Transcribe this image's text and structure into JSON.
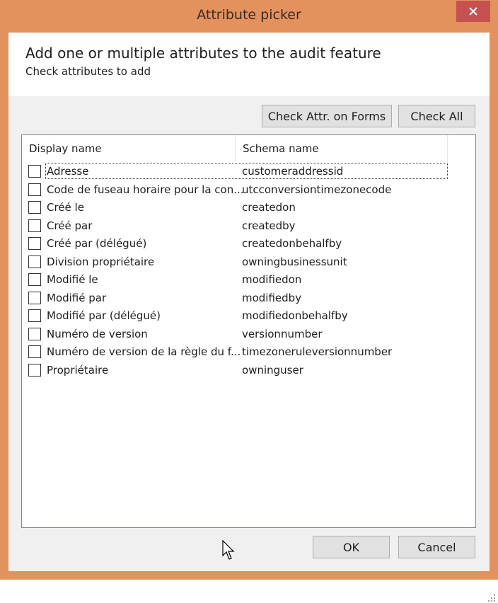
{
  "window": {
    "title": "Attribute picker"
  },
  "header": {
    "title": "Add one or multiple attributes to the audit feature",
    "subtitle": "Check attributes to add"
  },
  "toolbar": {
    "check_forms_label": "Check Attr. on Forms",
    "check_all_label": "Check All"
  },
  "list": {
    "columns": [
      "Display name",
      "Schema name"
    ],
    "rows": [
      {
        "display": "Adresse",
        "schema": "customeraddressid",
        "checked": false
      },
      {
        "display": "Code de fuseau horaire pour la con...",
        "schema": "utcconversiontimezonecode",
        "checked": false
      },
      {
        "display": "Créé le",
        "schema": "createdon",
        "checked": false
      },
      {
        "display": "Créé par",
        "schema": "createdby",
        "checked": false
      },
      {
        "display": "Créé par (délégué)",
        "schema": "createdonbehalfby",
        "checked": false
      },
      {
        "display": "Division propriétaire",
        "schema": "owningbusinessunit",
        "checked": false
      },
      {
        "display": "Modifié le",
        "schema": "modifiedon",
        "checked": false
      },
      {
        "display": "Modifié par",
        "schema": "modifiedby",
        "checked": false
      },
      {
        "display": "Modifié par (délégué)",
        "schema": "modifiedonbehalfby",
        "checked": false
      },
      {
        "display": "Numéro de version",
        "schema": "versionnumber",
        "checked": false
      },
      {
        "display": "Numéro de version de la règle du f...",
        "schema": "timezoneruleversionnumber",
        "checked": false
      },
      {
        "display": "Propriétaire",
        "schema": "owninguser",
        "checked": false
      }
    ]
  },
  "footer": {
    "ok_label": "OK",
    "cancel_label": "Cancel"
  },
  "colors": {
    "frame": "#e3925e",
    "close": "#c75050",
    "dialog_bg": "#f0f0f0"
  },
  "icons": [
    "close-icon",
    "mouse-cursor-icon",
    "resize-grip-icon"
  ]
}
